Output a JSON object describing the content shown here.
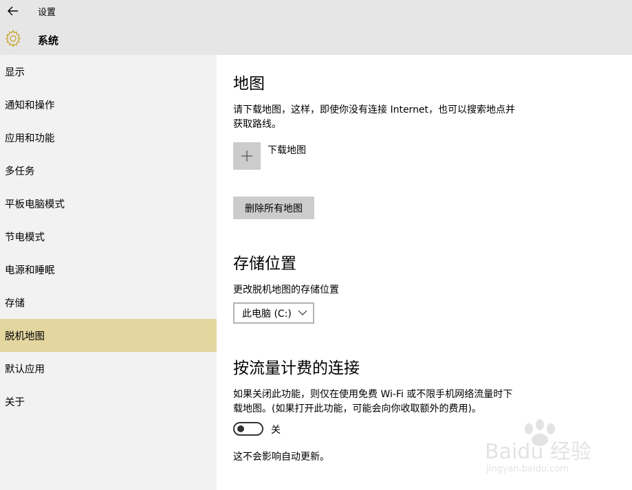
{
  "titlebar": {
    "app_title": "设置",
    "section_title": "系统",
    "back_icon": "back-arrow-icon",
    "section_icon": "gear-icon",
    "accent_color": "#e3d69f"
  },
  "sidebar": {
    "items": [
      {
        "label": "显示"
      },
      {
        "label": "通知和操作"
      },
      {
        "label": "应用和功能"
      },
      {
        "label": "多任务"
      },
      {
        "label": "平板电脑模式"
      },
      {
        "label": "节电模式"
      },
      {
        "label": "电源和睡眠"
      },
      {
        "label": "存储"
      },
      {
        "label": "脱机地图",
        "selected": true
      },
      {
        "label": "默认应用"
      },
      {
        "label": "关于"
      }
    ]
  },
  "main": {
    "maps": {
      "heading": "地图",
      "desc_line1": "请下载地图，这样，即使你没有连接 Internet，也可以搜索地点并",
      "desc_line2": "获取路线。",
      "download_label": "下载地图",
      "delete_all_label": "删除所有地图"
    },
    "storage": {
      "heading": "存储位置",
      "desc": "更改脱机地图的存储位置",
      "selected_location": "此电脑 (C:)"
    },
    "metered": {
      "heading": "按流量计费的连接",
      "desc_line1": "如果关闭此功能，则仅在使用免费 Wi-Fi 或不限手机网络流量时下",
      "desc_line2": "载地图。(如果打开此功能，可能会向你收取额外的费用)。",
      "toggle_state": "关",
      "toggle_on": false,
      "note": "这不会影响自动更新。"
    }
  },
  "watermark": {
    "brand": "Baidu 经验",
    "url": "jingyan.baidu.com"
  }
}
